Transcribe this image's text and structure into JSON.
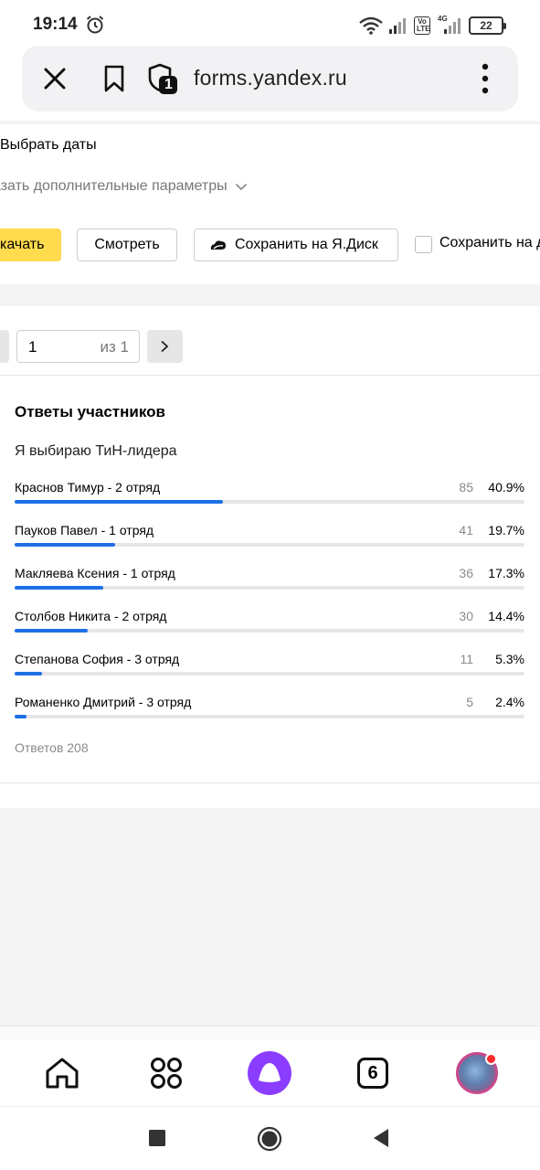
{
  "status_bar": {
    "time": "19:14",
    "battery": "22",
    "volte_top": "Vo",
    "volte_bottom": "LTE",
    "network": "4G"
  },
  "browser": {
    "url": "forms.yandex.ru",
    "shield_badge": "1"
  },
  "export": {
    "choose_dates": "Выбрать даты",
    "more_params": "азать дополнительные параметры",
    "download_label": "качать",
    "view_label": "Смотреть",
    "save_disk_label": "Сохранить на Я.Диск",
    "save_checkbox_label": "Сохранить на д"
  },
  "pager": {
    "page": "1",
    "of_label": "из 1"
  },
  "results": {
    "section_title": "Ответы участников",
    "question": "Я выбираю ТиН-лидера",
    "answers": [
      {
        "label": "Краснов Тимур - 2 отряд",
        "count": "85",
        "percent": "40.9%",
        "fraction": 0.409
      },
      {
        "label": "Пауков Павел - 1 отряд",
        "count": "41",
        "percent": "19.7%",
        "fraction": 0.197
      },
      {
        "label": "Макляева Ксения - 1 отряд",
        "count": "36",
        "percent": "17.3%",
        "fraction": 0.173
      },
      {
        "label": "Столбов Никита - 2 отряд",
        "count": "30",
        "percent": "14.4%",
        "fraction": 0.144
      },
      {
        "label": "Степанова София - 3 отряд",
        "count": "11",
        "percent": "5.3%",
        "fraction": 0.053
      },
      {
        "label": "Романенко Дмитрий - 3 отряд",
        "count": "5",
        "percent": "2.4%",
        "fraction": 0.024
      }
    ],
    "total": "Ответов 208"
  },
  "bottom_nav": {
    "tabs_count": "6"
  },
  "colors": {
    "accent_yellow": "#ffdb4d",
    "bar_blue": "#1e6fe6",
    "alice_purple": "#8b3dff"
  }
}
